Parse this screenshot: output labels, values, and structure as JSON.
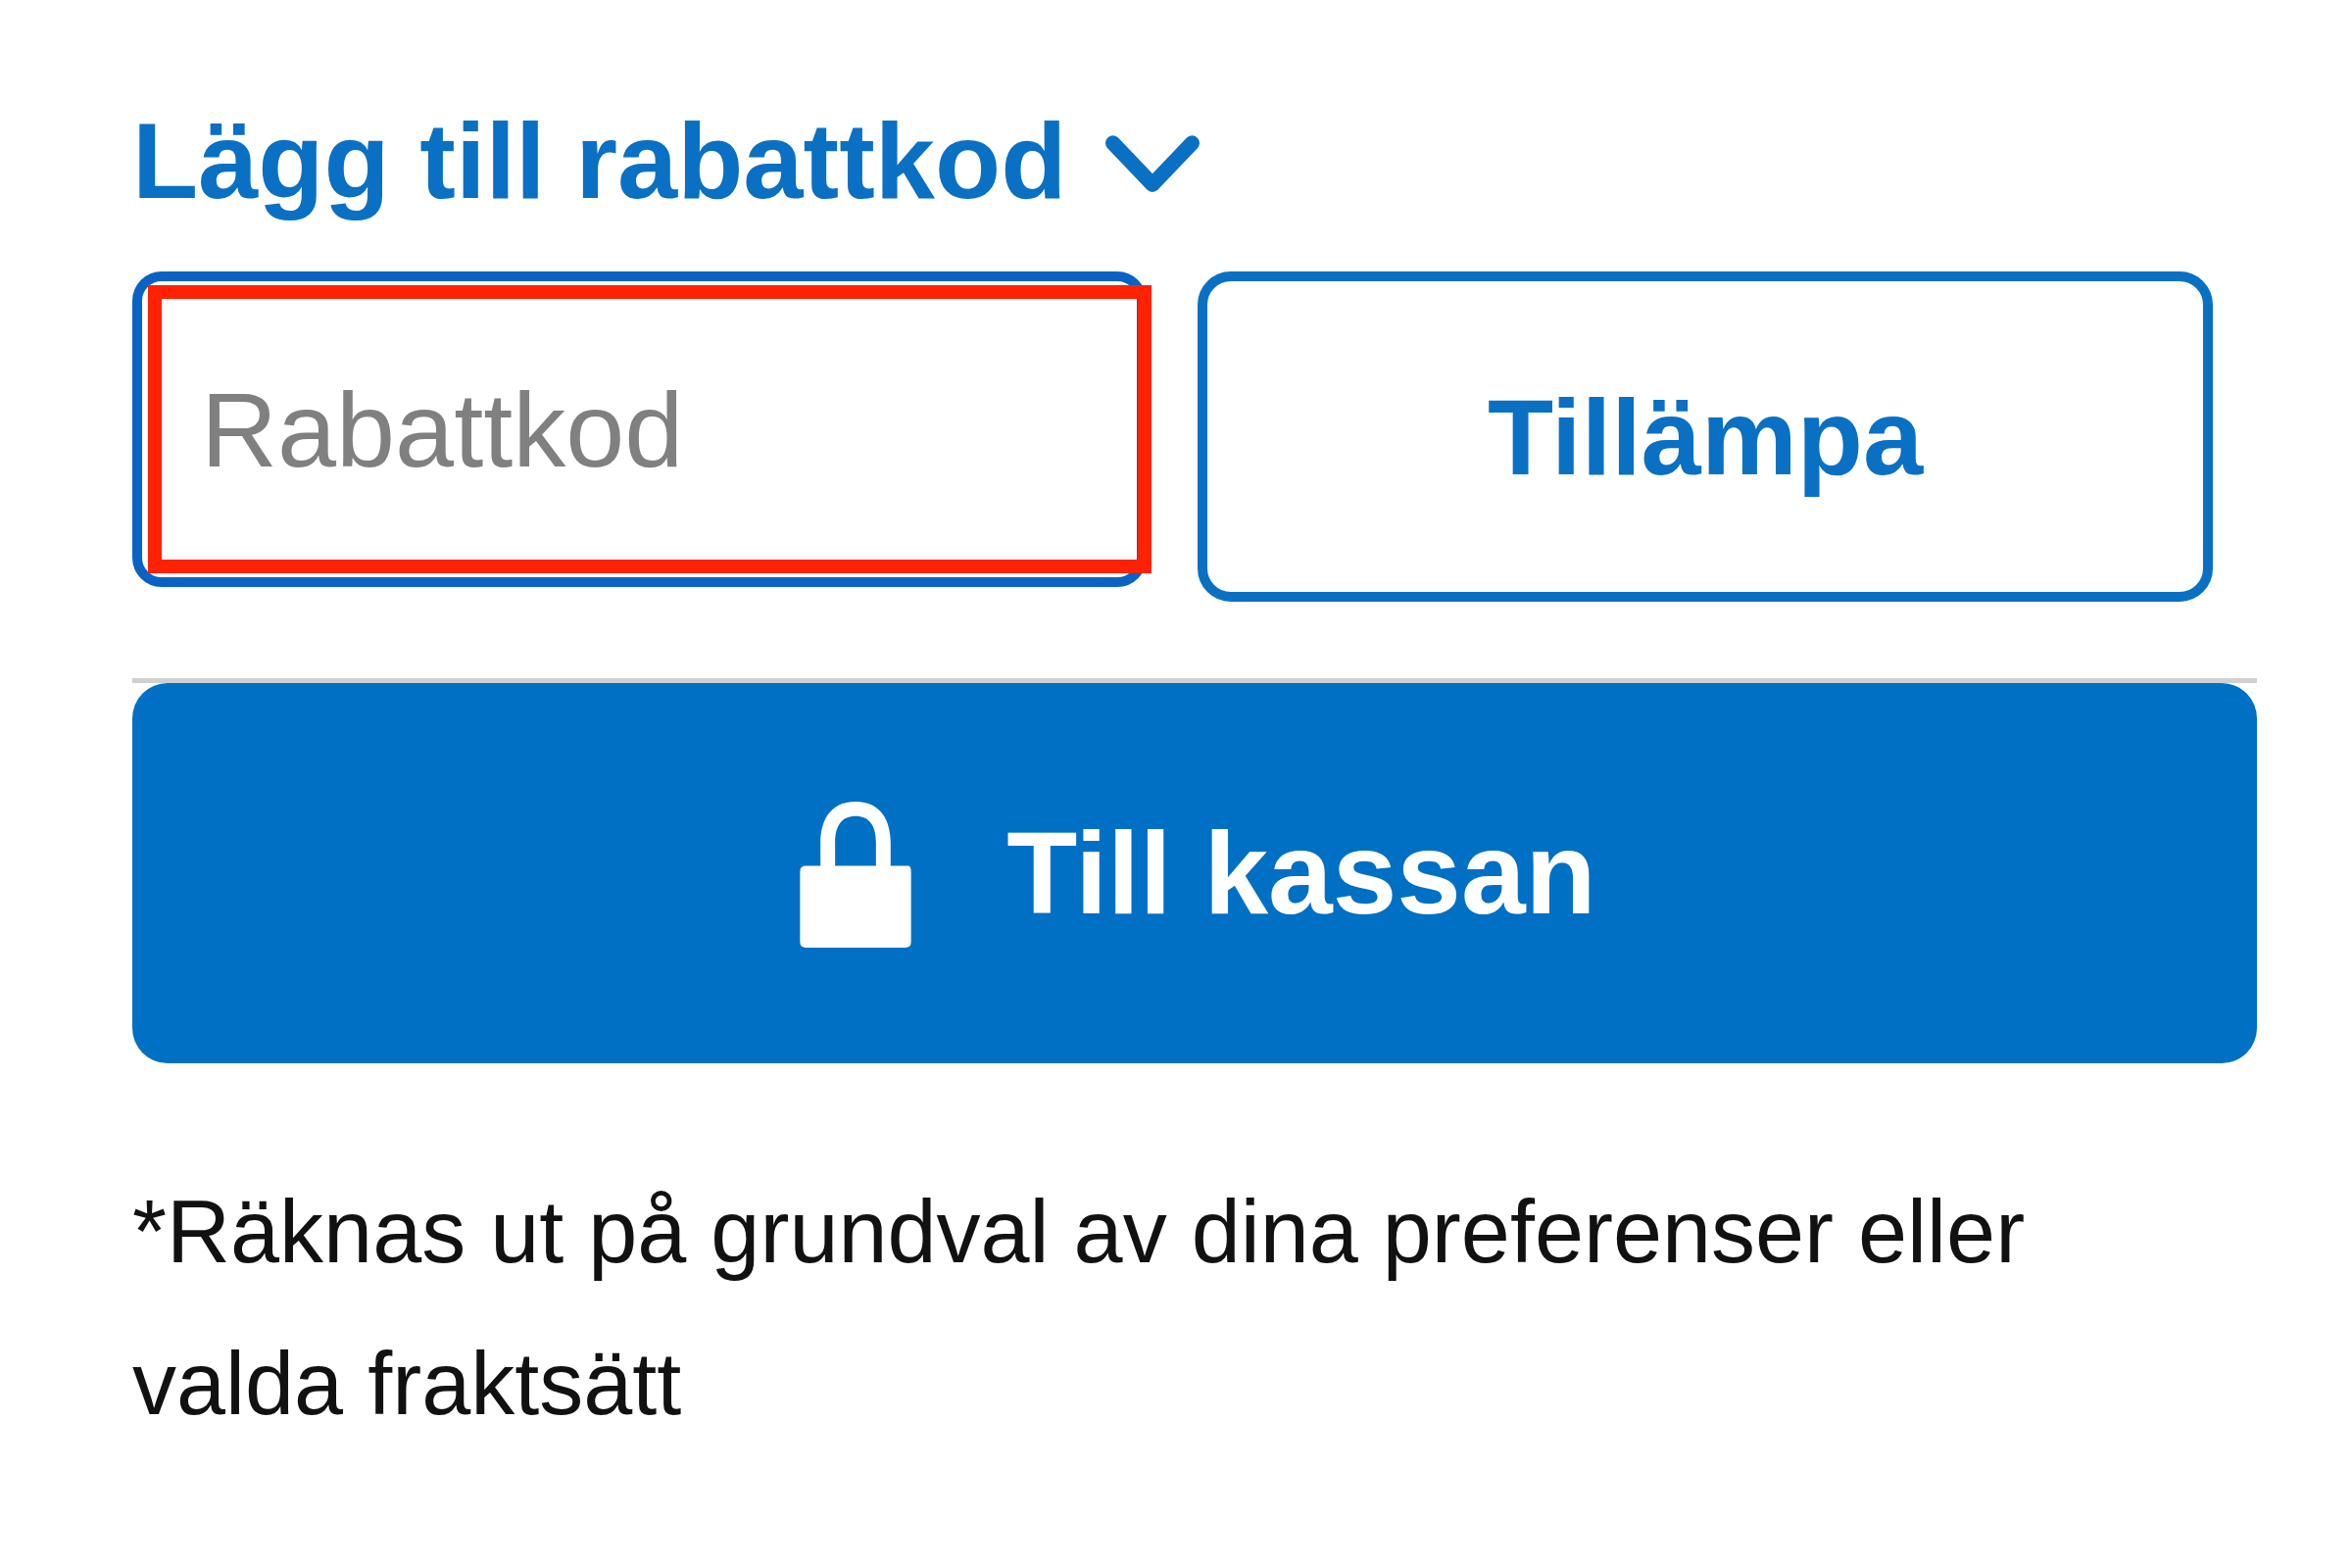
{
  "discount_toggle": {
    "label": "Lägg till rabattkod",
    "expanded": true
  },
  "coupon_field": {
    "placeholder": "Rabattkod",
    "highlighted": true
  },
  "apply_button": {
    "label": "Tillämpa"
  },
  "checkout_button": {
    "label": "Till kassan"
  },
  "note": "*Räknas ut på grundval av dina preferenser eller valda fraktsätt"
}
